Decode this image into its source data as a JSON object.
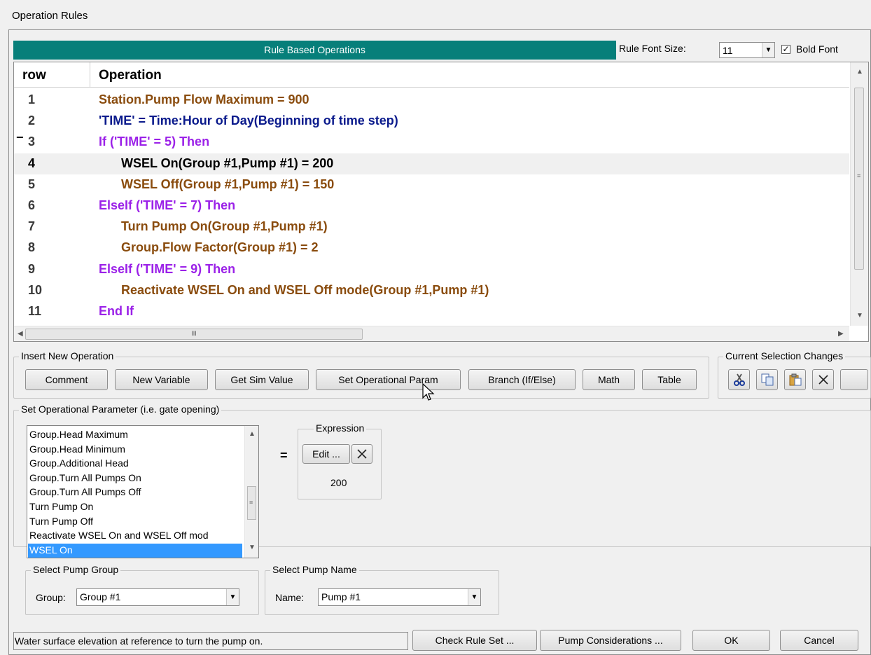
{
  "window": {
    "title": "Operation Rules"
  },
  "rules_panel": {
    "header": "Rule Based Operations",
    "font_size_label": "Rule Font Size:",
    "font_size_value": "11",
    "bold_font_label": "Bold Font",
    "bold_font_checked": true
  },
  "grid": {
    "columns": [
      "row",
      "Operation"
    ],
    "collapse_marker": "−",
    "rows": [
      {
        "num": "1",
        "op": "Station.Pump Flow Maximum = 900",
        "color": "#8a4c0e",
        "indent": 0
      },
      {
        "num": "2",
        "op": "'TIME' = Time:Hour of Day(Beginning of time step)",
        "color": "#0a1a8c",
        "indent": 0
      },
      {
        "num": "3",
        "op": "If ('TIME' = 5) Then",
        "color": "#9b21e8",
        "indent": 0
      },
      {
        "num": "4",
        "op": "WSEL On(Group #1,Pump #1) = 200",
        "color": "#000000",
        "indent": 1,
        "selected": true
      },
      {
        "num": "5",
        "op": "WSEL Off(Group #1,Pump #1) = 150",
        "color": "#8a4c0e",
        "indent": 1
      },
      {
        "num": "6",
        "op": "ElseIf ('TIME' = 7) Then",
        "color": "#9b21e8",
        "indent": 0
      },
      {
        "num": "7",
        "op": "Turn Pump On(Group #1,Pump #1)",
        "color": "#8a4c0e",
        "indent": 1
      },
      {
        "num": "8",
        "op": "Group.Flow Factor(Group #1) = 2",
        "color": "#8a4c0e",
        "indent": 1
      },
      {
        "num": "9",
        "op": "ElseIf ('TIME' = 9) Then",
        "color": "#9b21e8",
        "indent": 0
      },
      {
        "num": "10",
        "op": "Reactivate WSEL On and WSEL Off mode(Group #1,Pump #1)",
        "color": "#8a4c0e",
        "indent": 1
      },
      {
        "num": "11",
        "op": "End If",
        "color": "#9b21e8",
        "indent": 0
      }
    ],
    "hscroll_grip": "III"
  },
  "insert_group": {
    "label": "Insert New Operation",
    "buttons": [
      "Comment",
      "New Variable",
      "Get Sim Value",
      "Set Operational Param",
      "Branch (If/Else)",
      "Math",
      "Table"
    ]
  },
  "selection_group": {
    "label": "Current Selection Changes"
  },
  "param_group": {
    "label": "Set Operational Parameter (i.e. gate opening)",
    "list_items": [
      "Group.Head Maximum",
      "Group.Head Minimum",
      "Group.Additional Head",
      "Group.Turn All Pumps On",
      "Group.Turn All Pumps Off",
      "Turn Pump On",
      "Turn Pump Off",
      "Reactivate WSEL On and WSEL Off mod",
      "WSEL On"
    ],
    "selected_item": "WSEL On",
    "equals": "=",
    "expression_label": "Expression",
    "edit_button": "Edit ...",
    "expression_value": "200",
    "pump_group_label": "Select Pump Group",
    "group_field_label": "Group:",
    "group_value": "Group #1",
    "pump_name_label": "Select Pump Name",
    "name_field_label": "Name:",
    "name_value": "Pump #1"
  },
  "footer": {
    "status": "Water surface elevation at reference to turn the pump on.",
    "check_button": "Check Rule Set ...",
    "pump_button": "Pump Considerations ...",
    "ok_button": "OK",
    "cancel_button": "Cancel"
  }
}
